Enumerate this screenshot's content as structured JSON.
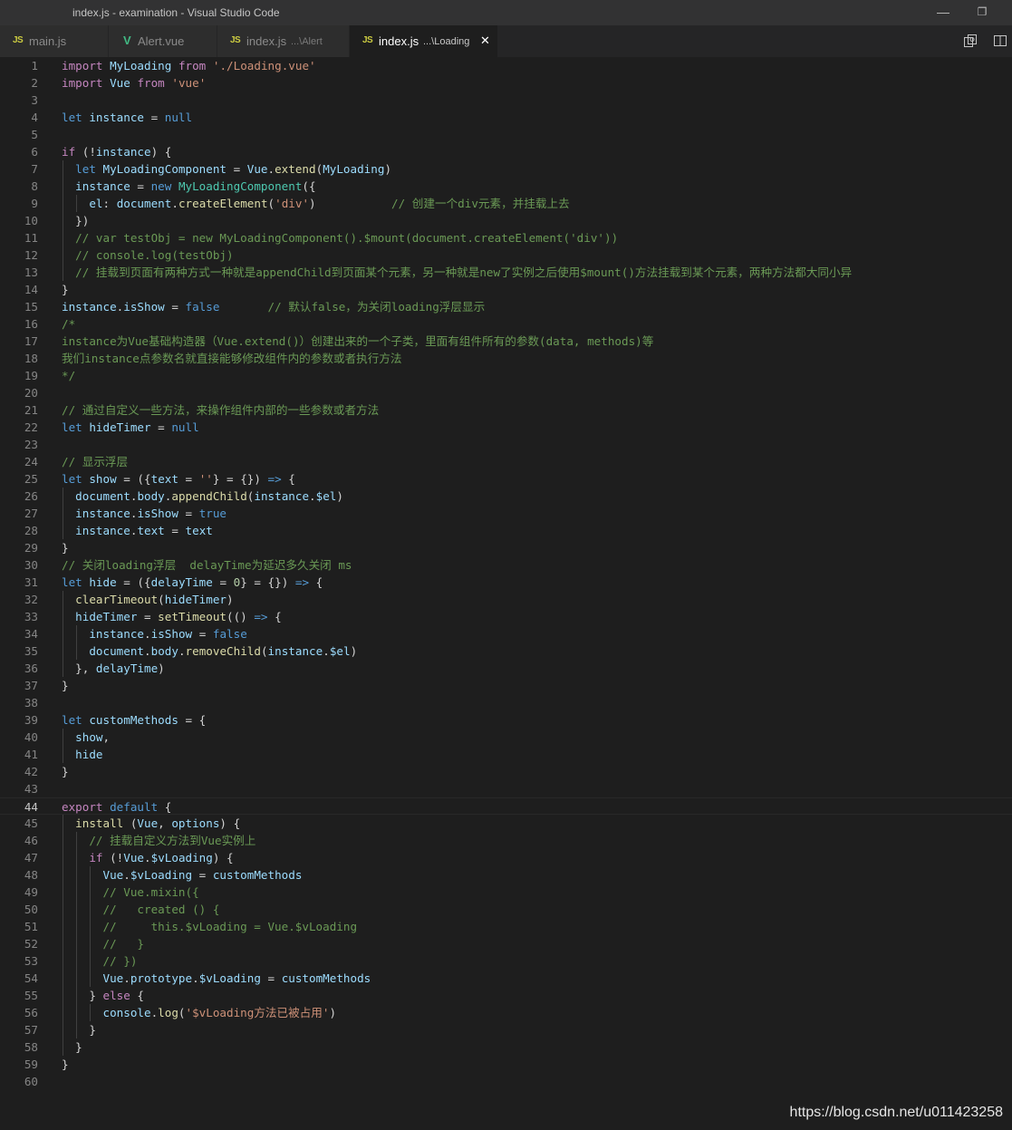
{
  "window": {
    "title": "index.js - examination - Visual Studio Code",
    "minimize_glyph": "—",
    "restore_glyph": "❐"
  },
  "tabs": [
    {
      "icon": "JS",
      "name": "main.js",
      "desc": ""
    },
    {
      "icon": "V",
      "name": "Alert.vue",
      "desc": ""
    },
    {
      "icon": "JS",
      "name": "index.js",
      "desc": "...\\Alert"
    },
    {
      "icon": "JS",
      "name": "index.js",
      "desc": "...\\Loading",
      "close": "✕"
    }
  ],
  "toolbar_icons": [
    "open-changes-icon",
    "split-editor-icon"
  ],
  "editor": {
    "current_line": 44,
    "lines": [
      {
        "n": "1",
        "t": "import MyLoading from './Loading.vue'"
      },
      {
        "n": "2",
        "t": "import Vue from 'vue'"
      },
      {
        "n": "3",
        "t": ""
      },
      {
        "n": "4",
        "t": "let instance = null"
      },
      {
        "n": "5",
        "t": ""
      },
      {
        "n": "6",
        "t": "if (!instance) {"
      },
      {
        "n": "7",
        "t": "  let MyLoadingComponent = Vue.extend(MyLoading)"
      },
      {
        "n": "8",
        "t": "  instance = new MyLoadingComponent({"
      },
      {
        "n": "9",
        "t": "    el: document.createElement('div')           // 创建一个div元素，并挂载上去"
      },
      {
        "n": "10",
        "t": "  })"
      },
      {
        "n": "11",
        "t": "  // var testObj = new MyLoadingComponent().$mount(document.createElement('div'))"
      },
      {
        "n": "12",
        "t": "  // console.log(testObj)"
      },
      {
        "n": "13",
        "t": "  // 挂载到页面有两种方式一种就是appendChild到页面某个元素，另一种就是new了实例之后使用$mount()方法挂载到某个元素，两种方法都大同小异"
      },
      {
        "n": "14",
        "t": "}"
      },
      {
        "n": "15",
        "t": "instance.isShow = false       // 默认false，为关闭loading浮层显示"
      },
      {
        "n": "16",
        "t": "/*"
      },
      {
        "n": "17",
        "t": "instance为Vue基础构造器（Vue.extend()）创建出来的一个子类，里面有组件所有的参数(data, methods)等"
      },
      {
        "n": "18",
        "t": "我们instance点参数名就直接能够修改组件内的参数或者执行方法"
      },
      {
        "n": "19",
        "t": "*/"
      },
      {
        "n": "20",
        "t": ""
      },
      {
        "n": "21",
        "t": "// 通过自定义一些方法，来操作组件内部的一些参数或者方法"
      },
      {
        "n": "22",
        "t": "let hideTimer = null"
      },
      {
        "n": "23",
        "t": ""
      },
      {
        "n": "24",
        "t": "// 显示浮层"
      },
      {
        "n": "25",
        "t": "let show = ({text = ''} = {}) => {"
      },
      {
        "n": "26",
        "t": "  document.body.appendChild(instance.$el)"
      },
      {
        "n": "27",
        "t": "  instance.isShow = true"
      },
      {
        "n": "28",
        "t": "  instance.text = text"
      },
      {
        "n": "29",
        "t": "}"
      },
      {
        "n": "30",
        "t": "// 关闭loading浮层  delayTime为延迟多久关闭 ms"
      },
      {
        "n": "31",
        "t": "let hide = ({delayTime = 0} = {}) => {"
      },
      {
        "n": "32",
        "t": "  clearTimeout(hideTimer)"
      },
      {
        "n": "33",
        "t": "  hideTimer = setTimeout(() => {"
      },
      {
        "n": "34",
        "t": "    instance.isShow = false"
      },
      {
        "n": "35",
        "t": "    document.body.removeChild(instance.$el)"
      },
      {
        "n": "36",
        "t": "  }, delayTime)"
      },
      {
        "n": "37",
        "t": "}"
      },
      {
        "n": "38",
        "t": ""
      },
      {
        "n": "39",
        "t": "let customMethods = {"
      },
      {
        "n": "40",
        "t": "  show,"
      },
      {
        "n": "41",
        "t": "  hide"
      },
      {
        "n": "42",
        "t": "}"
      },
      {
        "n": "43",
        "t": ""
      },
      {
        "n": "44",
        "t": "export default {"
      },
      {
        "n": "45",
        "t": "  install (Vue, options) {"
      },
      {
        "n": "46",
        "t": "    // 挂载自定义方法到Vue实例上"
      },
      {
        "n": "47",
        "t": "    if (!Vue.$vLoading) {"
      },
      {
        "n": "48",
        "t": "      Vue.$vLoading = customMethods"
      },
      {
        "n": "49",
        "t": "      // Vue.mixin({"
      },
      {
        "n": "50",
        "t": "      //   created () {"
      },
      {
        "n": "51",
        "t": "      //     this.$vLoading = Vue.$vLoading"
      },
      {
        "n": "52",
        "t": "      //   }"
      },
      {
        "n": "53",
        "t": "      // })"
      },
      {
        "n": "54",
        "t": "      Vue.prototype.$vLoading = customMethods"
      },
      {
        "n": "55",
        "t": "    } else {"
      },
      {
        "n": "56",
        "t": "      console.log('$vLoading方法已被占用')"
      },
      {
        "n": "57",
        "t": "    }"
      },
      {
        "n": "58",
        "t": "  }"
      },
      {
        "n": "59",
        "t": "}"
      },
      {
        "n": "60",
        "t": ""
      }
    ]
  },
  "watermark": "https://blog.csdn.net/u011423258",
  "theme": {
    "background": "#1e1e1e",
    "keyword": "#569cd6",
    "control": "#c586c0",
    "variable": "#9cdcfe",
    "function": "#dcdcaa",
    "string": "#ce9178",
    "comment": "#6a9955",
    "class": "#4ec9b0"
  }
}
